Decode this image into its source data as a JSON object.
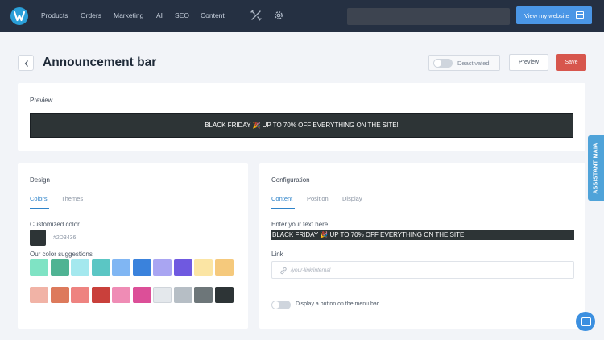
{
  "nav": {
    "items": [
      "Products",
      "Orders",
      "Marketing",
      "AI",
      "SEO",
      "Content"
    ],
    "view_website": "View my website"
  },
  "header": {
    "title": "Announcement bar",
    "status_label": "Deactivated",
    "preview_label": "Preview",
    "save_label": "Save"
  },
  "preview_card": {
    "title": "Preview",
    "bar_text": "BLACK FRIDAY 🎉 UP TO 70% OFF EVERYTHING ON THE SITE!"
  },
  "design": {
    "title": "Design",
    "tabs": [
      "Colors",
      "Themes"
    ],
    "customized_label": "Customized color",
    "customized_value": "#2D3436",
    "suggestions_label": "Our color suggestions",
    "swatches_row1": [
      "#7fe3c4",
      "#4fb393",
      "#a4e8ee",
      "#5bc6c4",
      "#80b6f3",
      "#3a82dc",
      "#a9a5f2",
      "#6f59e0",
      "#fbe5a4",
      "#f5c97c"
    ],
    "swatches_row2": [
      "#f1b3a6",
      "#dd7a5c",
      "#ee8380",
      "#c9403b",
      "#ef8cb5",
      "#dc4f98",
      "#e4e8ec",
      "#b6bec5",
      "#6d7679",
      "#2d3436"
    ]
  },
  "configuration": {
    "title": "Configuration",
    "tabs": [
      "Content",
      "Position",
      "Display"
    ],
    "text_label": "Enter your text here",
    "text_value": "BLACK FRIDAY 🎉 UP TO 70% OFF EVERYTHING ON THE SITE!",
    "link_label": "Link",
    "link_placeholder": "/your-link/internal",
    "menu_toggle_label": "Display a button on the menu bar."
  },
  "assistant_label": "ASSISTANT MAIA"
}
